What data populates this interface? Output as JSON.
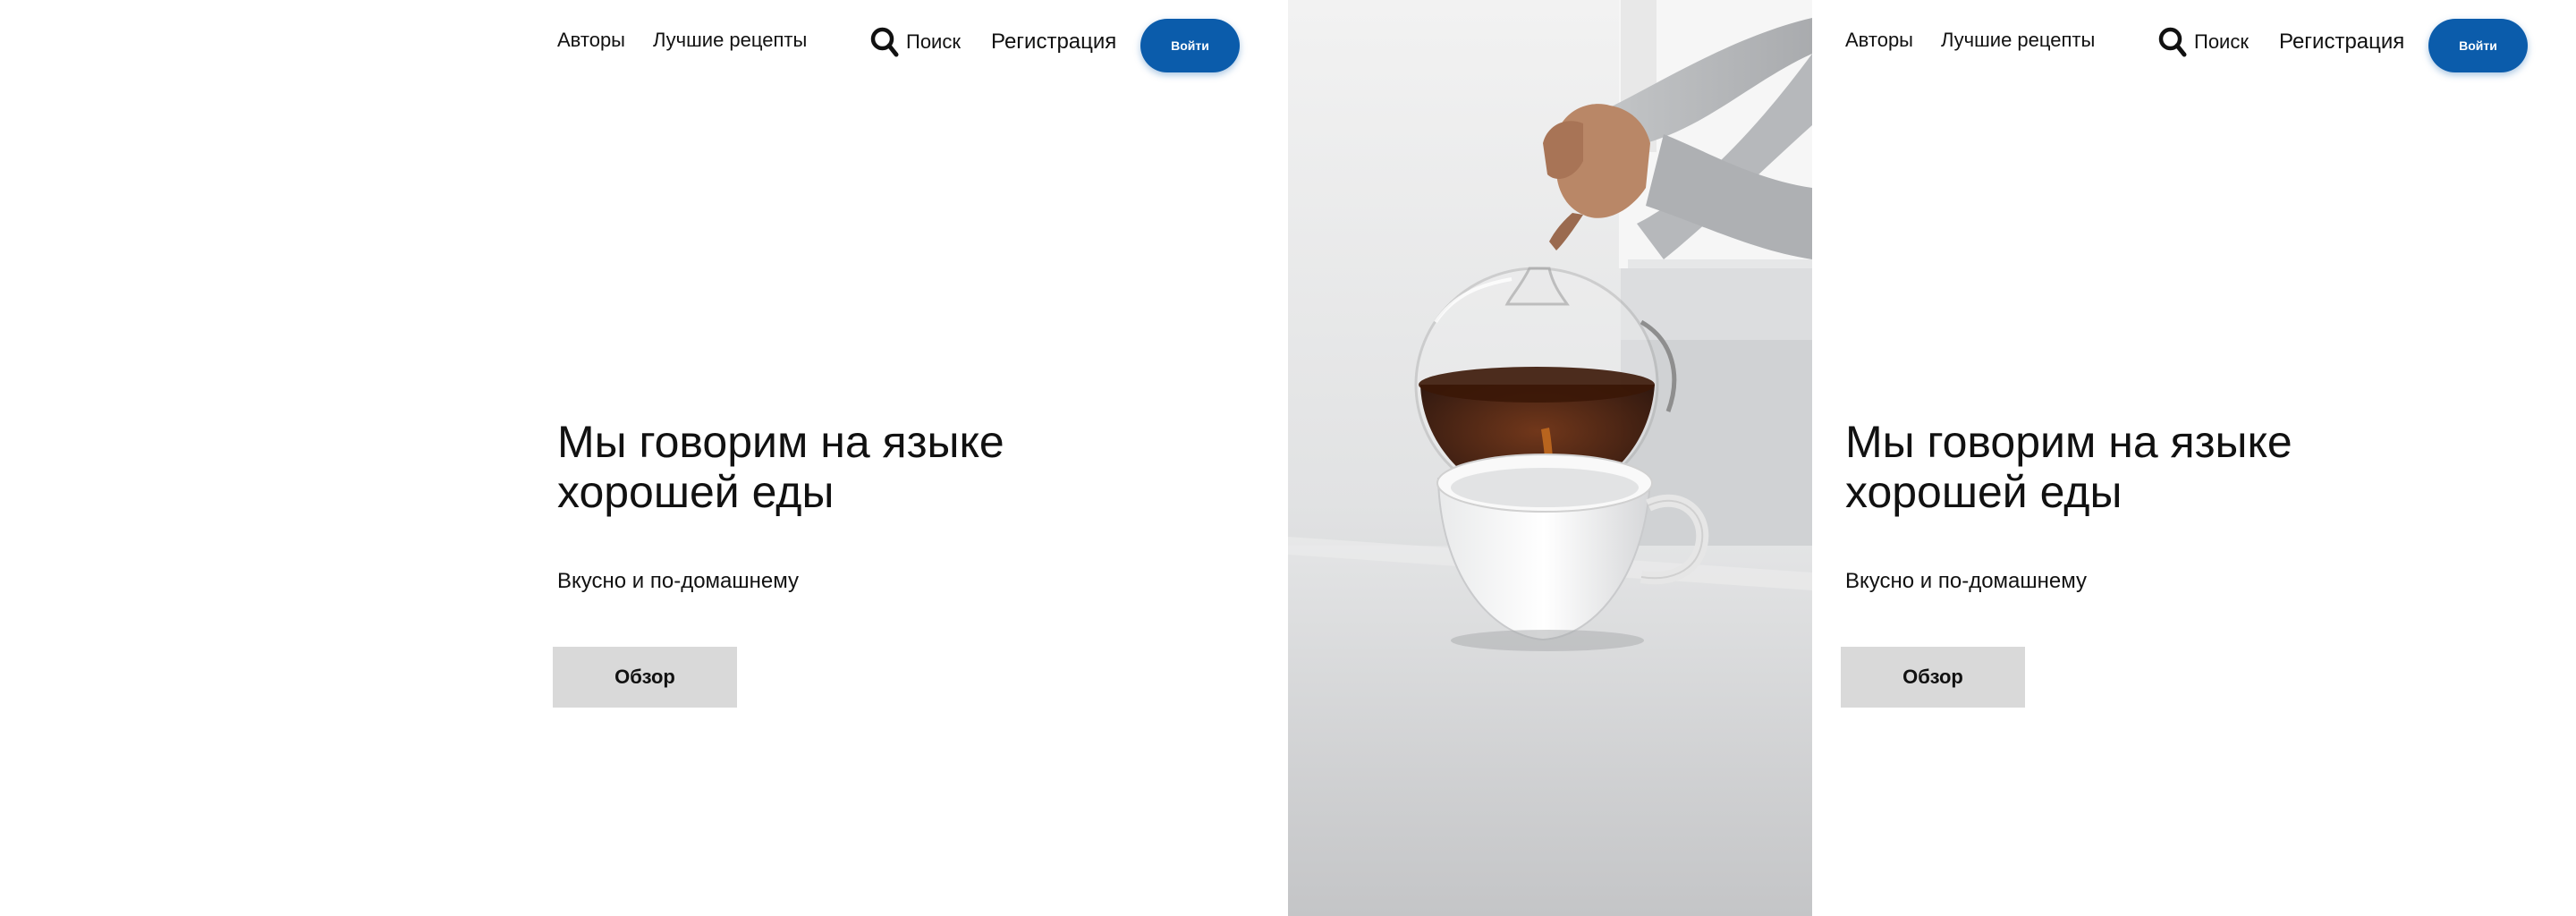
{
  "nav": {
    "authors_label": "Авторы",
    "best_recipes_label": "Лучшие рецепты",
    "search_label": "Поиск",
    "register_label": "Регистрация",
    "login_label": "Войти",
    "search_icon": "search-icon"
  },
  "hero": {
    "title": "Мы говорим на языке хорошей еды",
    "subtitle": "Вкусно и по-домашнему",
    "button_label": "Обзор"
  },
  "colors": {
    "accent": "#0b5cab",
    "button_gray": "#d9d9d9",
    "text": "#111111",
    "background": "#ffffff"
  }
}
